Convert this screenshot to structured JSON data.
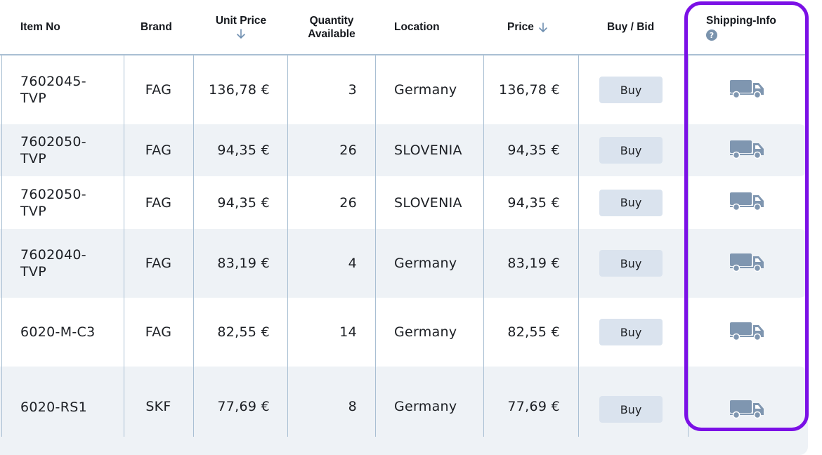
{
  "headers": {
    "item_no": "Item No",
    "brand": "Brand",
    "unit_price": "Unit Price",
    "quantity_line1": "Quantity",
    "quantity_line2": "Available",
    "location": "Location",
    "price": "Price",
    "buy_bid": "Buy / Bid",
    "shipping_info": "Shipping-Info",
    "help_glyph": "?"
  },
  "colors": {
    "highlight": "#7b10e6",
    "row_shade": "#eef2f6",
    "grid_line": "#a9bfd3",
    "buy_button": "#dae3ee",
    "truck_icon": "#7f96b0"
  },
  "icons": {
    "sort": "arrow-down-icon",
    "help": "question-circle-icon",
    "shipping": "truck-icon"
  },
  "rows": [
    {
      "item_line1": "7602045-",
      "item_line2": "TVP",
      "brand": "FAG",
      "unit_price": "136,78 €",
      "quantity": "3",
      "location": "Germany",
      "price": "136,78 €",
      "buy": "Buy"
    },
    {
      "item_line1": "7602050-",
      "item_line2": "TVP",
      "brand": "FAG",
      "unit_price": "94,35 €",
      "quantity": "26",
      "location": "SLOVENIA",
      "price": "94,35 €",
      "buy": "Buy"
    },
    {
      "item_line1": "7602050-",
      "item_line2": "TVP",
      "brand": "FAG",
      "unit_price": "94,35 €",
      "quantity": "26",
      "location": "SLOVENIA",
      "price": "94,35 €",
      "buy": "Buy"
    },
    {
      "item_line1": "7602040-",
      "item_line2": "TVP",
      "brand": "FAG",
      "unit_price": "83,19 €",
      "quantity": "4",
      "location": "Germany",
      "price": "83,19 €",
      "buy": "Buy"
    },
    {
      "item_line1": "6020-M-C3",
      "item_line2": "",
      "brand": "FAG",
      "unit_price": "82,55 €",
      "quantity": "14",
      "location": "Germany",
      "price": "82,55 €",
      "buy": "Buy"
    },
    {
      "item_line1": "6020-RS1",
      "item_line2": "",
      "brand": "SKF",
      "unit_price": "77,69 €",
      "quantity": "8",
      "location": "Germany",
      "price": "77,69 €",
      "buy": "Buy"
    }
  ]
}
